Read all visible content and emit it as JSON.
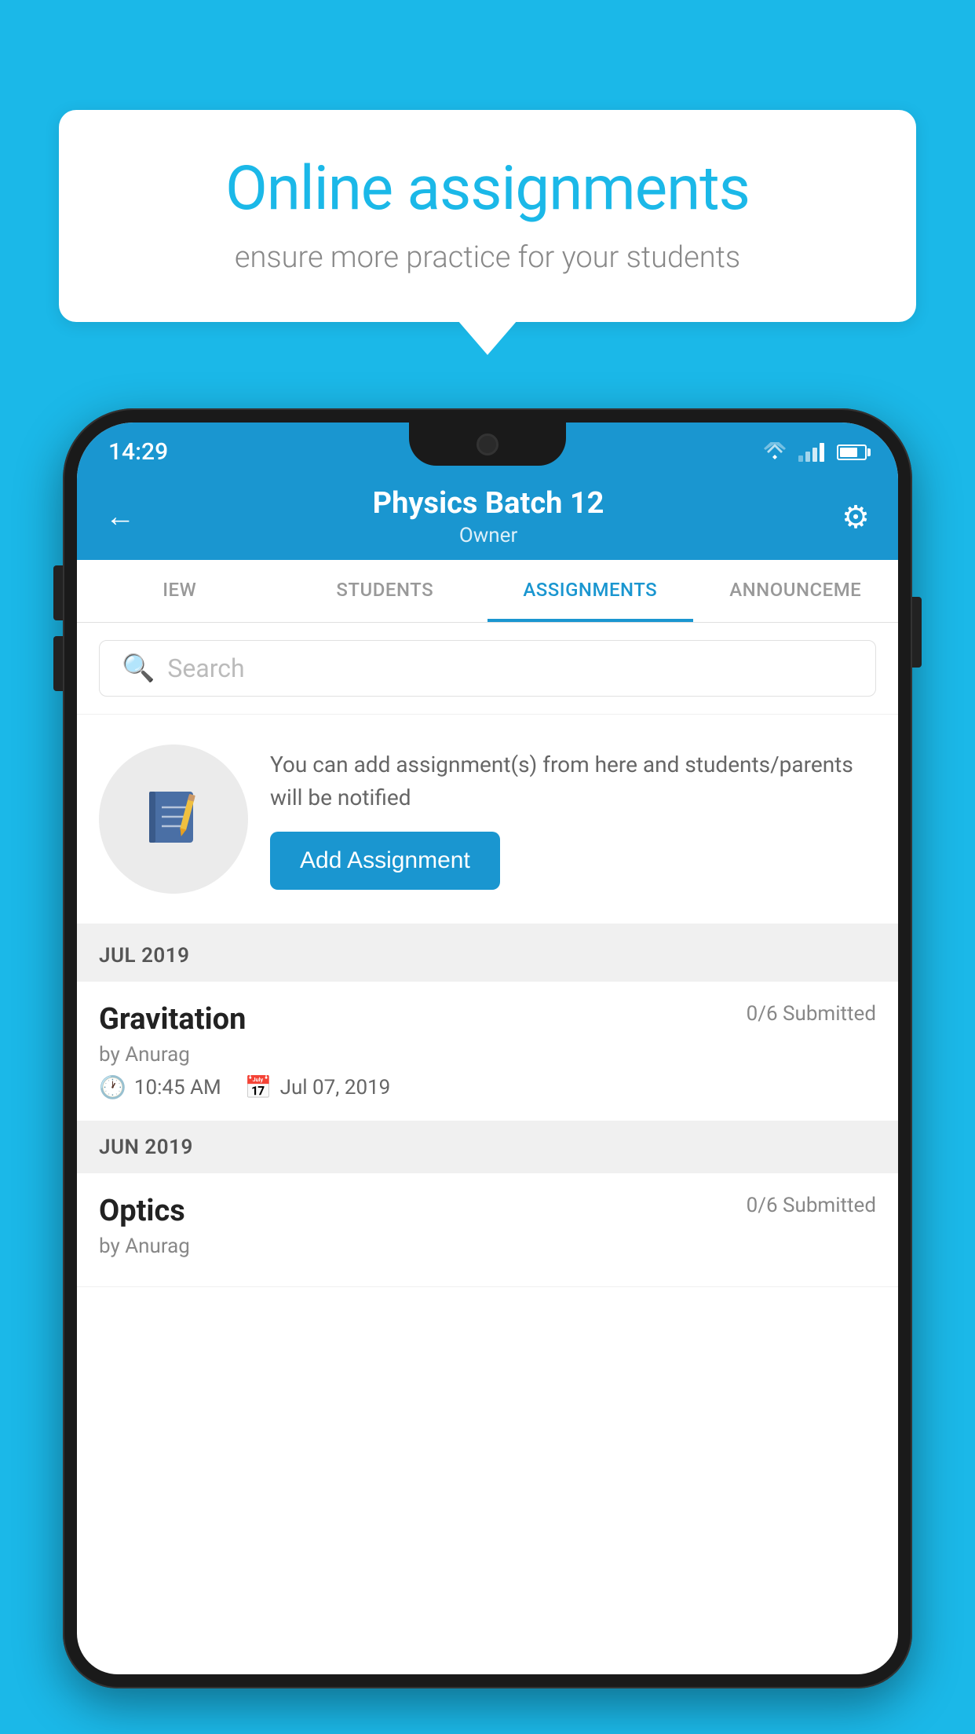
{
  "background_color": "#1BB8E8",
  "speech_bubble": {
    "title": "Online assignments",
    "subtitle": "ensure more practice for your students"
  },
  "status_bar": {
    "time": "14:29"
  },
  "app_header": {
    "title": "Physics Batch 12",
    "subtitle": "Owner"
  },
  "tabs": [
    {
      "label": "IEW",
      "active": false
    },
    {
      "label": "STUDENTS",
      "active": false
    },
    {
      "label": "ASSIGNMENTS",
      "active": true
    },
    {
      "label": "ANNOUNCEME",
      "active": false
    }
  ],
  "search": {
    "placeholder": "Search"
  },
  "promo": {
    "text": "You can add assignment(s) from here and students/parents will be notified",
    "button_label": "Add Assignment"
  },
  "sections": [
    {
      "month": "JUL 2019",
      "assignments": [
        {
          "name": "Gravitation",
          "submitted": "0/6 Submitted",
          "by": "by Anurag",
          "time": "10:45 AM",
          "date": "Jul 07, 2019"
        }
      ]
    },
    {
      "month": "JUN 2019",
      "assignments": [
        {
          "name": "Optics",
          "submitted": "0/6 Submitted",
          "by": "by Anurag",
          "time": "",
          "date": ""
        }
      ]
    }
  ]
}
